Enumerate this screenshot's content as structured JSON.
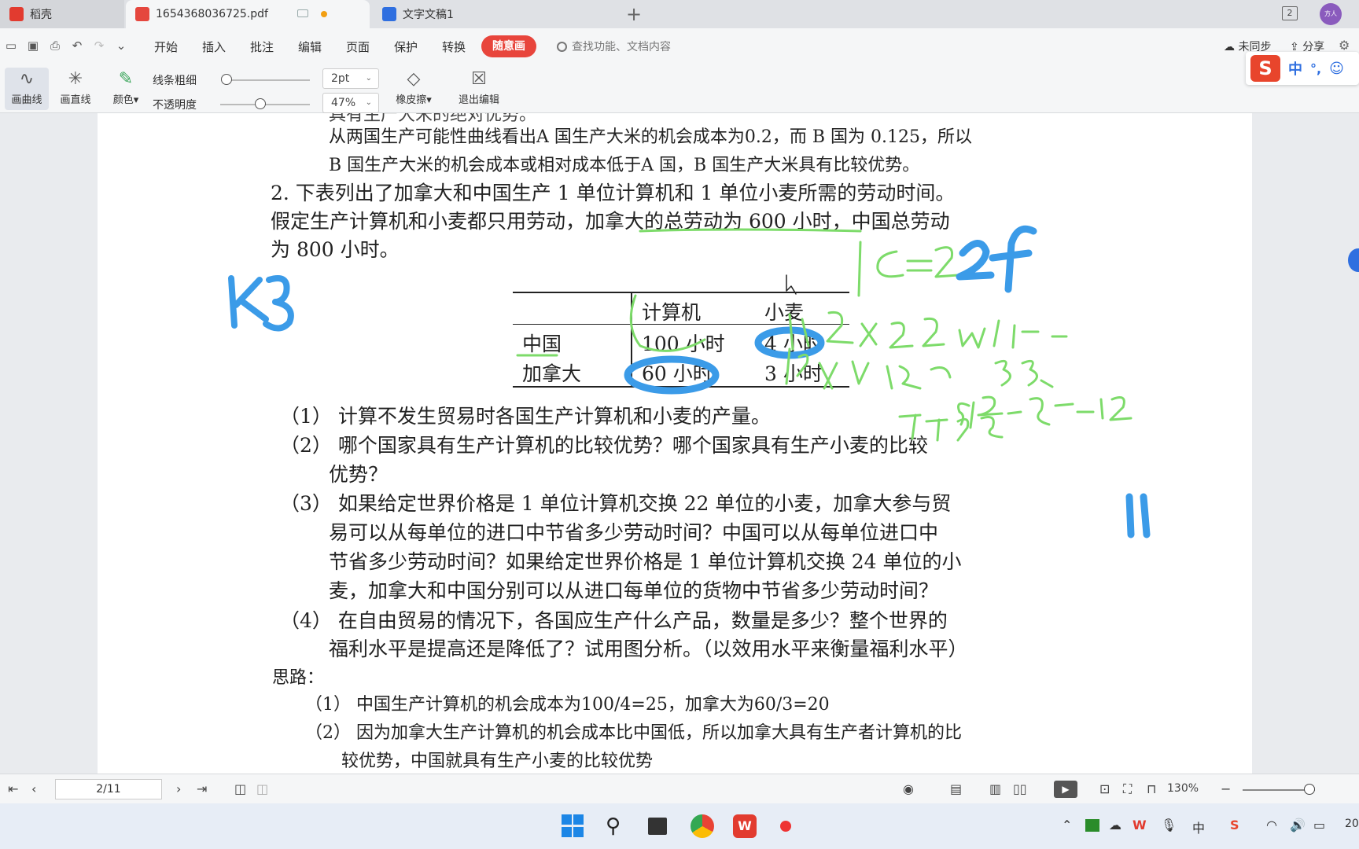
{
  "tabs": [
    {
      "label": "稻壳"
    },
    {
      "label": "1654368036725.pdf"
    },
    {
      "label": "文字文稿1"
    }
  ],
  "window": {
    "count_badge": "2",
    "avatar_text": "方人"
  },
  "menu": {
    "items": [
      "开始",
      "插入",
      "批注",
      "编辑",
      "页面",
      "保护",
      "转换"
    ],
    "active_pill": "随意画",
    "search_placeholder": "查找功能、文档内容",
    "sync_label": "未同步",
    "share_label": "分享"
  },
  "toolbar": {
    "draw_curve": "画曲线",
    "draw_line": "画直线",
    "color": "颜色",
    "line_width": "线条粗细",
    "opacity": "不透明度",
    "width_value": "2pt",
    "opacity_value": "47%",
    "eraser": "橡皮擦",
    "exit_edit": "退出编辑"
  },
  "ime": {
    "mode": "中",
    "punct": "°,"
  },
  "document": {
    "lines": [
      "从两国生产可能性曲线看出A 国生产大米的机会成本为0.2，而 B 国为 0.125，所以",
      "B 国生产大米的机会成本或相对成本低于A 国，B 国生产大米具有比较优势。",
      "2. 下表列出了加拿大和中国生产 1 单位计算机和 1 单位小麦所需的劳动时间。",
      "假定生产计算机和小麦都只用劳动，加拿大的总劳动为 600 小时，中国总劳动",
      "为 800 小时。"
    ],
    "table": {
      "headers": [
        "计算机",
        "小麦"
      ],
      "rows": [
        {
          "country": "中国",
          "computer": "100 小时",
          "wheat": "4 小时"
        },
        {
          "country": "加拿大",
          "computer": "60 小时",
          "wheat": "3 小时"
        }
      ]
    },
    "questions": [
      "（1）  计算不发生贸易时各国生产计算机和小麦的产量。",
      "（2）   哪个国家具有生产计算机的比较优势？哪个国家具有生产小麦的比较",
      "优势？",
      "（3）   如果给定世界价格是 1 单位计算机交换 22 单位的小麦，加拿大参与贸",
      "易可以从每单位的进口中节省多少劳动时间？中国可以从每单位进口中",
      "节省多少劳动时间？如果给定世界价格是 1 单位计算机交换 24 单位的小",
      "麦，加拿大和中国分别可以从进口每单位的货物中节省多少劳动时间？",
      "（4）   在自由贸易的情况下，各国应生产什么产品，数量是多少？整个世界的",
      "福利水平是提高还是降低了？试用图分析。（以效用水平来衡量福利水平）"
    ],
    "thinking_label": "思路：",
    "answers": [
      "（1）   中国生产计算机的机会成本为100/4=25，加拿大为60/3=20",
      "（2）   因为加拿大生产计算机的机会成本比中国低，所以加拿大具有生产者计算机的比",
      "较优势，中国就具有生产小麦的比较优势"
    ]
  },
  "annotations": {
    "blue_left": "K3",
    "blue_top_right": "2f",
    "green_formula": "c=2",
    "blue_eleven": "11"
  },
  "statusbar": {
    "page_indicator": "2/11",
    "zoom": "130%"
  },
  "taskbar": {
    "clock_partial": "20"
  },
  "colors": {
    "accent_red": "#e8453c",
    "ink_blue": "#3b9be8",
    "ink_green": "#7ddb6a"
  }
}
